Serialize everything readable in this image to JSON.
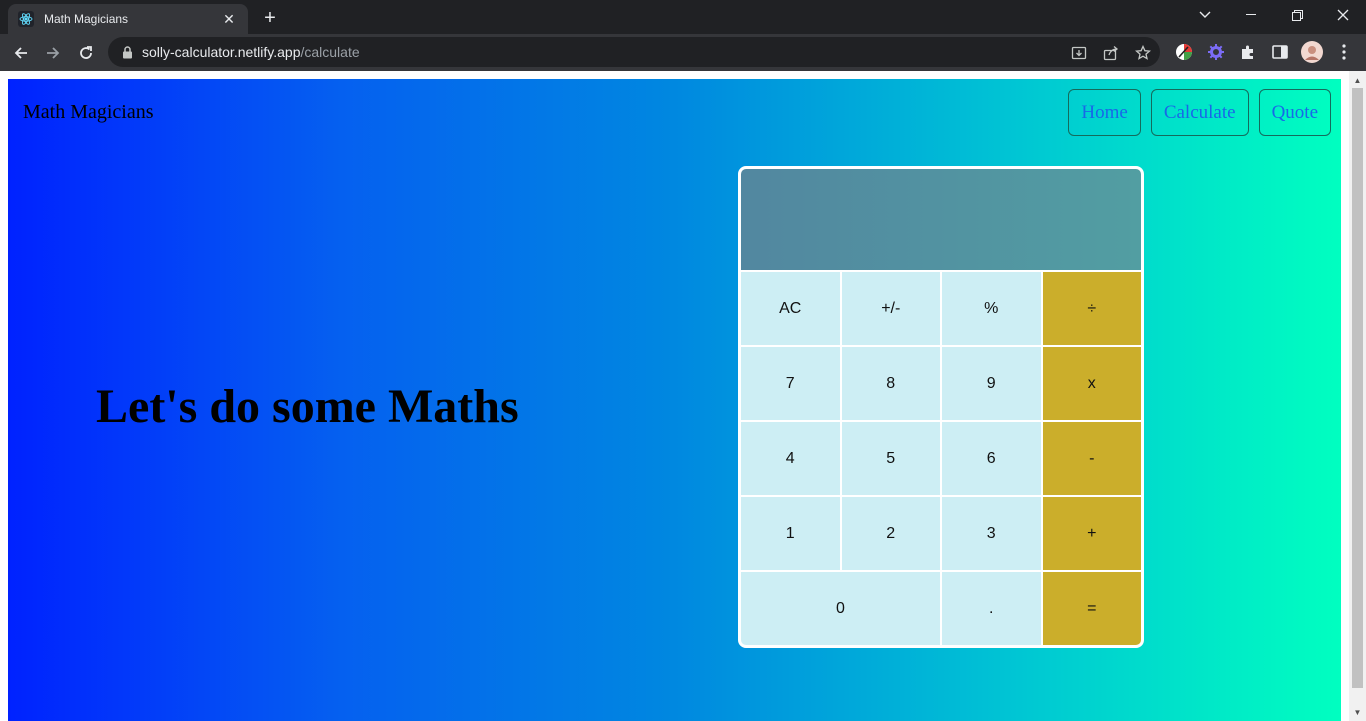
{
  "browser": {
    "tab_title": "Math Magicians",
    "tab_close": "✕",
    "new_tab": "+",
    "url_host": "solly-calculator.netlify.app",
    "url_path": "/calculate",
    "icons": {
      "back": "arrow-left-icon",
      "forward": "arrow-right-icon",
      "reload": "reload-icon",
      "lock": "lock-icon",
      "install": "install-icon",
      "share": "share-icon",
      "bookmark": "star-icon",
      "extensions": "puzzle-icon",
      "side_panel": "side-panel-icon",
      "profile": "avatar",
      "menu": "kebab-menu-icon"
    }
  },
  "site": {
    "logo": "Math Magicians",
    "nav": [
      {
        "label": "Home"
      },
      {
        "label": "Calculate"
      },
      {
        "label": "Quote"
      }
    ],
    "headline": "Let's do some Maths"
  },
  "calculator": {
    "display": "",
    "keys": [
      {
        "label": "AC",
        "type": "fn"
      },
      {
        "label": "+/-",
        "type": "fn"
      },
      {
        "label": "%",
        "type": "fn"
      },
      {
        "label": "÷",
        "type": "op"
      },
      {
        "label": "7",
        "type": "num"
      },
      {
        "label": "8",
        "type": "num"
      },
      {
        "label": "9",
        "type": "num"
      },
      {
        "label": "x",
        "type": "op"
      },
      {
        "label": "4",
        "type": "num"
      },
      {
        "label": "5",
        "type": "num"
      },
      {
        "label": "6",
        "type": "num"
      },
      {
        "label": "-",
        "type": "op"
      },
      {
        "label": "1",
        "type": "num"
      },
      {
        "label": "2",
        "type": "num"
      },
      {
        "label": "3",
        "type": "num"
      },
      {
        "label": "+",
        "type": "op"
      },
      {
        "label": "0",
        "type": "num"
      },
      {
        "label": ".",
        "type": "num"
      },
      {
        "label": "=",
        "type": "op"
      }
    ]
  },
  "colors": {
    "gradient_start": "#0022ff",
    "gradient_end": "#00ffc0",
    "display_bg": "#5290a1",
    "key_bg": "#cdeef4",
    "operator_bg": "#cbae2b",
    "nav_text": "#1868e8"
  }
}
